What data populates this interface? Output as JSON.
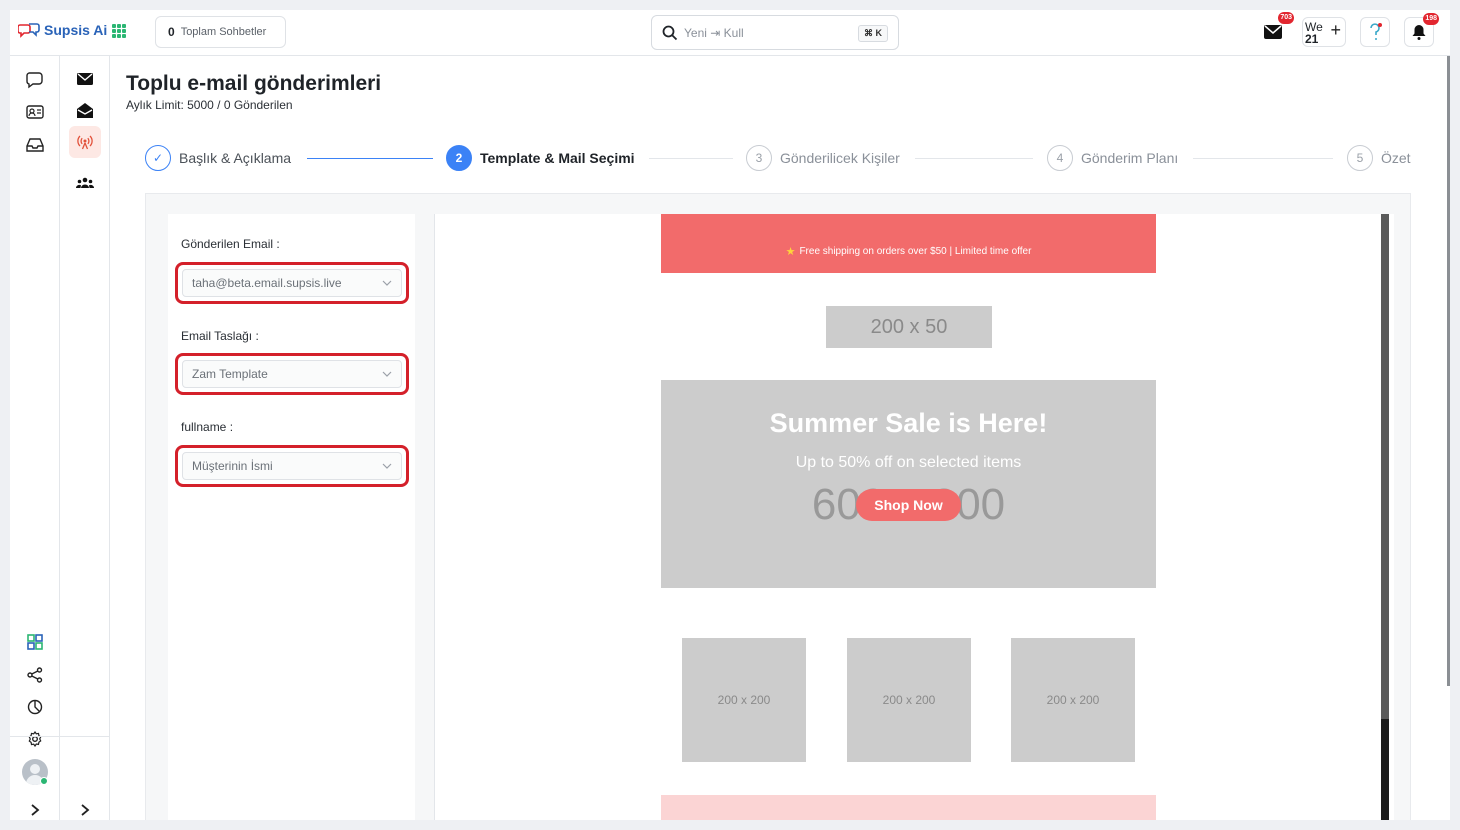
{
  "app": {
    "brand": "Supsis Ai"
  },
  "topbar": {
    "conversations_count": "0",
    "conversations_label": "Toplam Sohbetler",
    "search_text": "Yeni ⇥ Kull",
    "search_shortcut": "⌘ K",
    "mail_badge": "703",
    "date_day_name": "We",
    "date_day_number": "21",
    "notif_badge": "198"
  },
  "page": {
    "title": "Toplu e-mail gönderimleri",
    "subtitle": "Aylık Limit: 5000 / 0 Gönderilen"
  },
  "steps": [
    {
      "num": "✓",
      "label": "Başlık & Açıklama",
      "state": "done"
    },
    {
      "num": "2",
      "label": "Template & Mail Seçimi",
      "state": "active"
    },
    {
      "num": "3",
      "label": "Gönderilicek Kişiler",
      "state": "pending"
    },
    {
      "num": "4",
      "label": "Gönderim Planı",
      "state": "pending"
    },
    {
      "num": "5",
      "label": "Özet",
      "state": "pending"
    }
  ],
  "form": {
    "sender_label": "Gönderilen Email",
    "sender_value": "taha@beta.email.supsis.live",
    "template_label": "Email Taslağı",
    "template_value": "Zam Template",
    "fullname_label": "fullname",
    "fullname_value": "Müşterinin İsmi"
  },
  "preview": {
    "banner_text": "Free shipping on orders over $50 | Limited time offer",
    "logo_placeholder": "200 x 50",
    "hero_placeholder": "600 x 300",
    "hero_title": "Summer Sale is Here!",
    "hero_subtitle": "Up to 50% off on selected items",
    "hero_button": "Shop Now",
    "products": [
      "200 x 200",
      "200 x 200",
      "200 x 200"
    ]
  },
  "colors": {
    "brand_blue": "#3b82f6",
    "highlight_red": "#d4202a",
    "mail_coral": "#f26b6b",
    "placeholder_gray": "#cccccc"
  }
}
